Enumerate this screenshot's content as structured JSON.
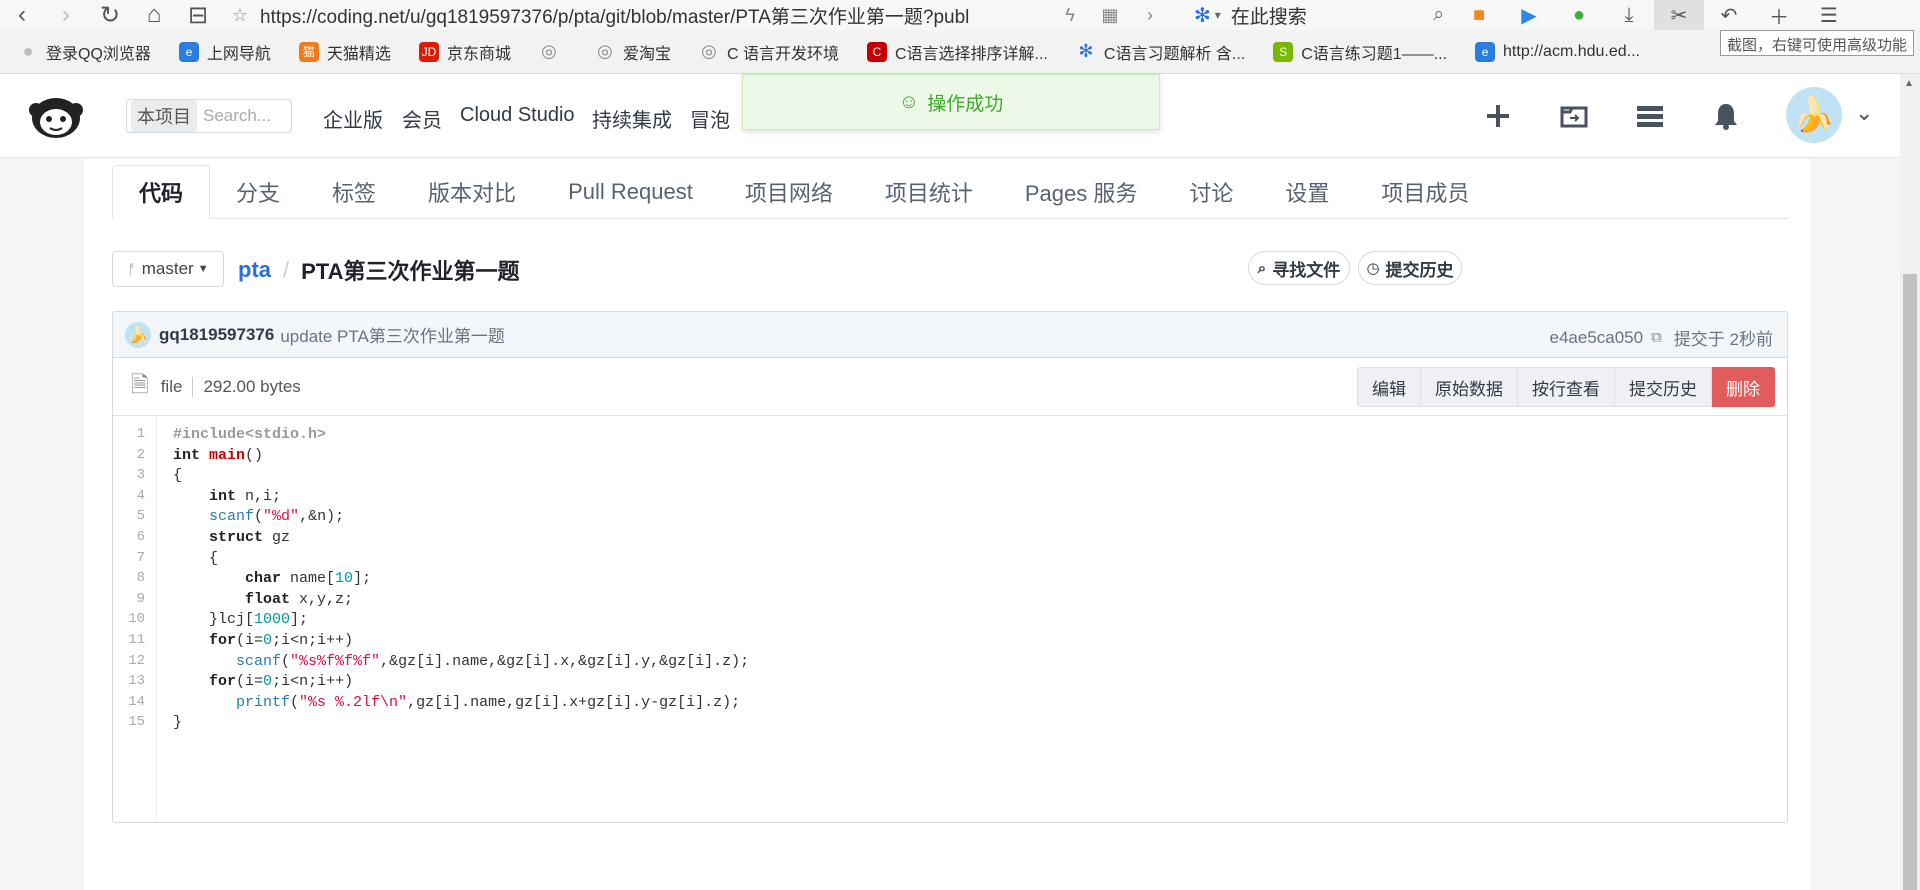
{
  "browser": {
    "url": "https://coding.net/u/gq1819597376/p/pta/git/blob/master/PTA第三次作业第一题?publ",
    "search_label": "在此搜索",
    "tooltip": "截图，右键可使用高级功能",
    "bookmarks": [
      {
        "label": "登录QQ浏览器",
        "icon": "user-icon",
        "color": "#bbbbbb"
      },
      {
        "label": "上网导航",
        "icon": "ie-icon",
        "color": "#2a7ee0"
      },
      {
        "label": "天猫精选",
        "icon": "tmall-icon",
        "color": "#f07b1c"
      },
      {
        "label": "京东商城",
        "icon": "jd-icon",
        "color": "#d81e06"
      },
      {
        "label": "",
        "icon": "globe-icon",
        "color": "#888888"
      },
      {
        "label": "爱淘宝",
        "icon": "globe-icon",
        "color": "#888888"
      },
      {
        "label": "C 语言开发环境",
        "icon": "globe-icon",
        "color": "#888888"
      },
      {
        "label": "C语言选择排序详解...",
        "icon": "csdn-icon",
        "color": "#c40000"
      },
      {
        "label": "C语言习题解析 含...",
        "icon": "baidu-paw-icon",
        "color": "#2a6fdb"
      },
      {
        "label": "C语言练习题1——...",
        "icon": "sogou-icon",
        "color": "#7ab800"
      },
      {
        "label": "http://acm.hdu.ed...",
        "icon": "ie-icon",
        "color": "#2a7ee0"
      }
    ]
  },
  "header": {
    "scope_label": "本项目",
    "search_placeholder": "Search...",
    "nav": [
      "企业版",
      "会员",
      "Cloud Studio",
      "持续集成",
      "冒泡"
    ],
    "toast": "操作成功"
  },
  "tabs": [
    "代码",
    "分支",
    "标签",
    "版本对比",
    "Pull Request",
    "项目网络",
    "项目统计",
    "Pages 服务",
    "讨论",
    "设置",
    "项目成员"
  ],
  "active_tab": "代码",
  "repo": {
    "branch": "master",
    "repo_name": "pta",
    "separator": "/",
    "file_name": "PTA第三次作业第一题",
    "find_file": "寻找文件",
    "history": "提交历史"
  },
  "commit": {
    "user": "gq1819597376",
    "message": "update PTA第三次作业第一题",
    "hash": "e4ae5ca050",
    "time": "提交于 2秒前"
  },
  "file": {
    "type": "file",
    "size": "292.00 bytes",
    "actions": [
      "编辑",
      "原始数据",
      "按行查看",
      "提交历史",
      "删除"
    ]
  },
  "code_lines": [
    "#include<stdio.h>",
    "int main()",
    "{",
    "    int n,i;",
    "    scanf(\"%d\",&n);",
    "    struct gz",
    "    {",
    "        char name[10];",
    "        float x,y,z;",
    "    }lcj[1000];",
    "    for(i=0;i<n;i++)",
    "       scanf(\"%s%f%f%f\",&gz[i].name,&gz[i].x,&gz[i].y,&gz[i].z);",
    "    for(i=0;i<n;i++)",
    "       printf(\"%s %.2lf\\n\",gz[i].name,gz[i].x+gz[i].y-gz[i].z);",
    "}"
  ],
  "colors": {
    "toast_green": "#3daa2a",
    "link_blue": "#2a6fdb",
    "danger_red": "#e05d5b"
  }
}
